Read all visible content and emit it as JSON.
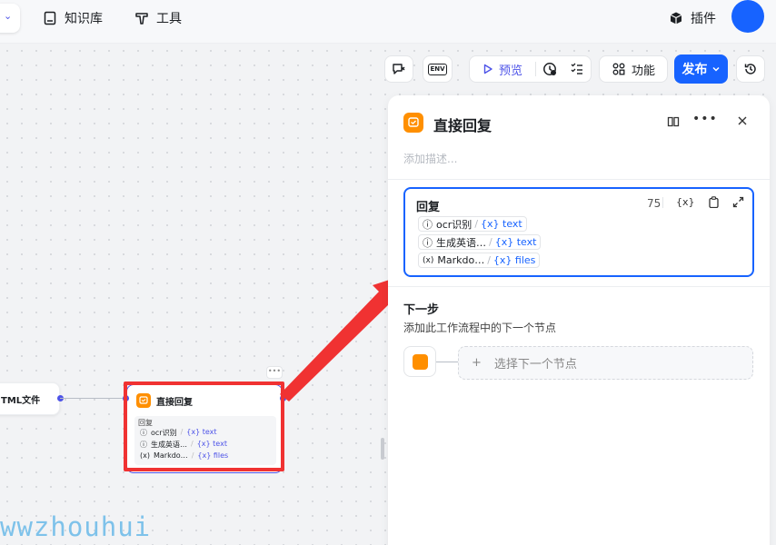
{
  "topnav": {
    "knowledge_label": "知识库",
    "tools_label": "工具",
    "plugin_label": "插件"
  },
  "toolbar": {
    "env_label": "ENV",
    "preview_label": "预览",
    "function_label": "功能",
    "publish_label": "发布"
  },
  "canvas": {
    "html_node_label": "TML文件",
    "reply_node": {
      "title": "直接回复",
      "section_label": "回复",
      "rows": [
        {
          "type": "ocr识别",
          "var": "{x} text"
        },
        {
          "type": "生成英语…",
          "var": "{x} text"
        },
        {
          "type": "Markdo…",
          "var": "{x} files"
        }
      ]
    }
  },
  "panel": {
    "title": "直接回复",
    "desc_placeholder": "添加描述...",
    "reply": {
      "label": "回复",
      "count": "75",
      "var_btn": "{x}",
      "rows": [
        {
          "type": "ocr识别",
          "var": "{x} text"
        },
        {
          "type": "生成英语…",
          "var": "{x} text"
        },
        {
          "type": "Markdo…",
          "var": "{x} files"
        }
      ]
    },
    "next": {
      "title": "下一步",
      "desc": "添加此工作流程中的下一个节点",
      "select_placeholder": "选择下一个节点"
    }
  },
  "watermark": "wwzhouhui",
  "colors": {
    "primary": "#1763ff",
    "accent": "#4d53e8",
    "node_icon": "#ff8f00",
    "highlight": "#f03232"
  }
}
